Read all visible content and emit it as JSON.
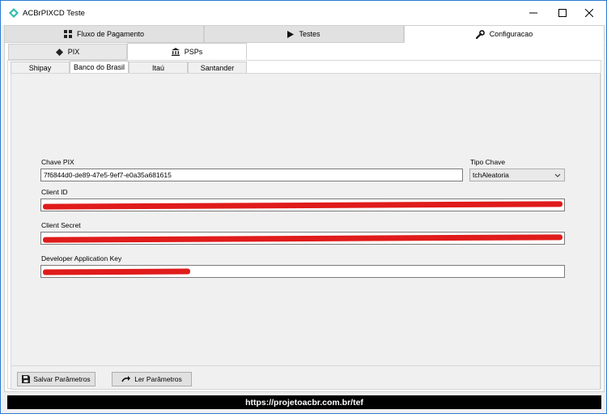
{
  "window": {
    "title": "ACBrPIXCD Teste",
    "accent": "#2b79d0"
  },
  "top_tabs": [
    {
      "label": "Fluxo de Pagamento",
      "icon": "grid-icon"
    },
    {
      "label": "Testes",
      "icon": "play-icon"
    },
    {
      "label": "Configuracao",
      "icon": "wrench-icon",
      "active": true
    }
  ],
  "sub_tabs": [
    {
      "label": "PIX",
      "icon": "pix-diamond-icon"
    },
    {
      "label": "PSPs",
      "icon": "bank-icon",
      "active": true
    }
  ],
  "psp_tabs": [
    {
      "label": "Shipay"
    },
    {
      "label": "Banco do Brasil",
      "active": true
    },
    {
      "label": "Itaú"
    },
    {
      "label": "Santander"
    }
  ],
  "form": {
    "chave_pix_label": "Chave PIX",
    "chave_pix_value": "7f6844d0-de89-47e5-9ef7-e0a35a681615",
    "tipo_chave_label": "Tipo Chave",
    "tipo_chave_value": "tchAleatoria",
    "client_id_label": "Client ID",
    "client_secret_label": "Client Secret",
    "dev_key_label": "Developer Application Key",
    "redaction_color": "#e01b1b"
  },
  "buttons": {
    "save": "Salvar Parâmetros",
    "load": "Ler Parâmetros"
  },
  "footer": {
    "text": "https://projetoacbr.com.br/tef"
  }
}
